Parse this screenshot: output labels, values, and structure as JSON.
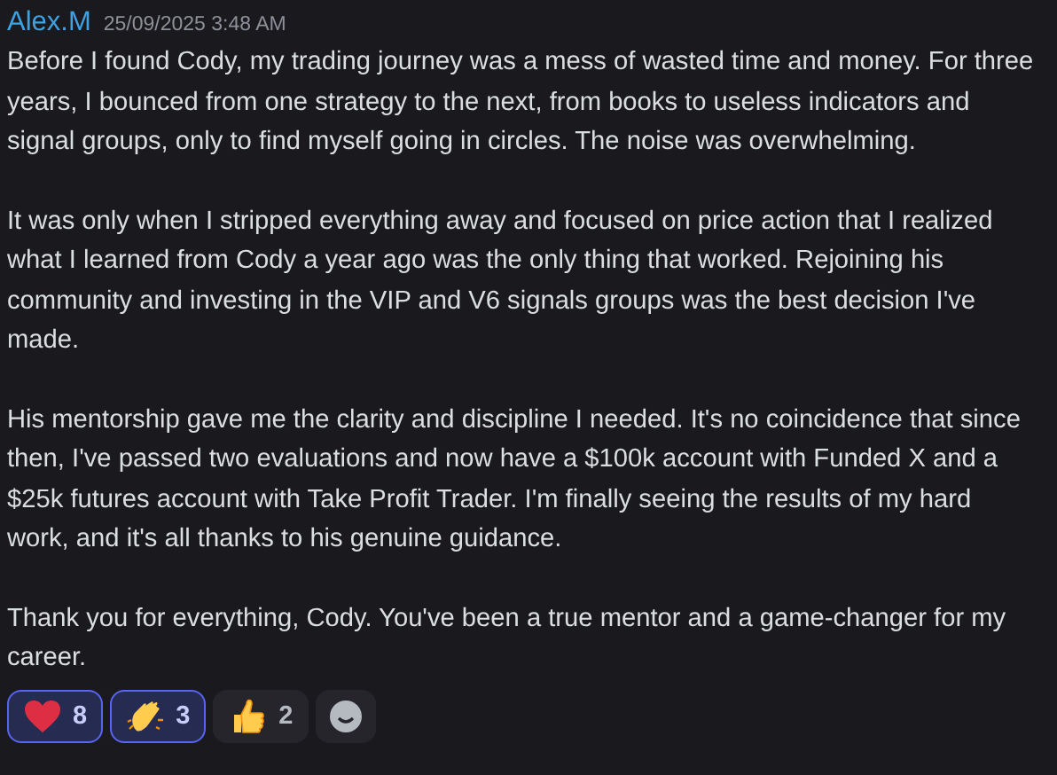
{
  "message": {
    "author": "Alex.M",
    "timestamp": "25/09/2025 3:48 AM",
    "paragraphs": [
      "Before I found Cody, my trading journey was a mess of wasted time and money. For three years, I bounced from one strategy to the next, from books to useless indicators and signal groups, only to find myself going in circles. The noise was overwhelming.",
      "It was only when I stripped everything away and focused on price action that I realized what I learned from Cody a year ago was the only thing that worked. Rejoining his community and investing in the VIP and V6 signals groups was the best decision I've made.",
      "His mentorship gave me the clarity and discipline I needed. It's no coincidence that since then, I've passed two evaluations and now have a $100k account with Funded X and a $25k futures account with Take Profit Trader. I'm finally seeing the results of my hard work, and it's all thanks to his genuine guidance.",
      "Thank you for everything, Cody. You've been a true mentor and a game-changer for my career."
    ],
    "reactions": [
      {
        "kind": "heart",
        "count": "8",
        "selected": true
      },
      {
        "kind": "clap",
        "count": "3",
        "selected": true
      },
      {
        "kind": "thumbs-up",
        "count": "2",
        "selected": false
      }
    ]
  }
}
